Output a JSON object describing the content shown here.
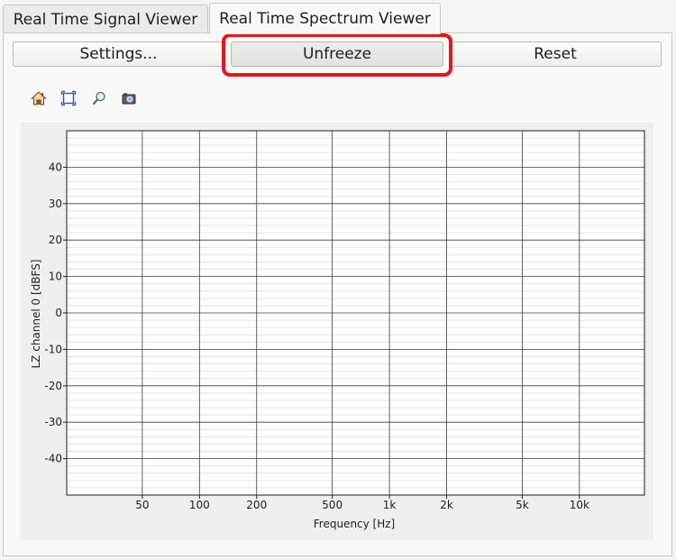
{
  "tabs": [
    {
      "label": "Real Time Signal Viewer"
    },
    {
      "label": "Real Time Spectrum Viewer"
    }
  ],
  "buttons": {
    "settings": "Settings...",
    "unfreeze": "Unfreeze",
    "reset": "Reset"
  },
  "toolbar": {
    "icons": [
      "home-icon",
      "zoom-fit-icon",
      "magnifier-icon",
      "camera-icon"
    ]
  },
  "colors": {
    "highlight": "#e8161c",
    "background": "#f5f5f4"
  },
  "chart_data": {
    "type": "line",
    "xlabel": "Frequency [Hz]",
    "ylabel": "LZ channel 0 [dBFS]",
    "x_scale": "log",
    "xlim": [
      20,
      22000
    ],
    "ylim": [
      -50,
      50
    ],
    "x_ticks": [
      {
        "value": 50,
        "label": "50"
      },
      {
        "value": 100,
        "label": "100"
      },
      {
        "value": 200,
        "label": "200"
      },
      {
        "value": 500,
        "label": "500"
      },
      {
        "value": 1000,
        "label": "1k"
      },
      {
        "value": 2000,
        "label": "2k"
      },
      {
        "value": 5000,
        "label": "5k"
      },
      {
        "value": 10000,
        "label": "10k"
      }
    ],
    "y_ticks": [
      40,
      30,
      20,
      10,
      0,
      -10,
      -20,
      -30,
      -40
    ],
    "grid": true,
    "minor_grid": true,
    "series": []
  }
}
